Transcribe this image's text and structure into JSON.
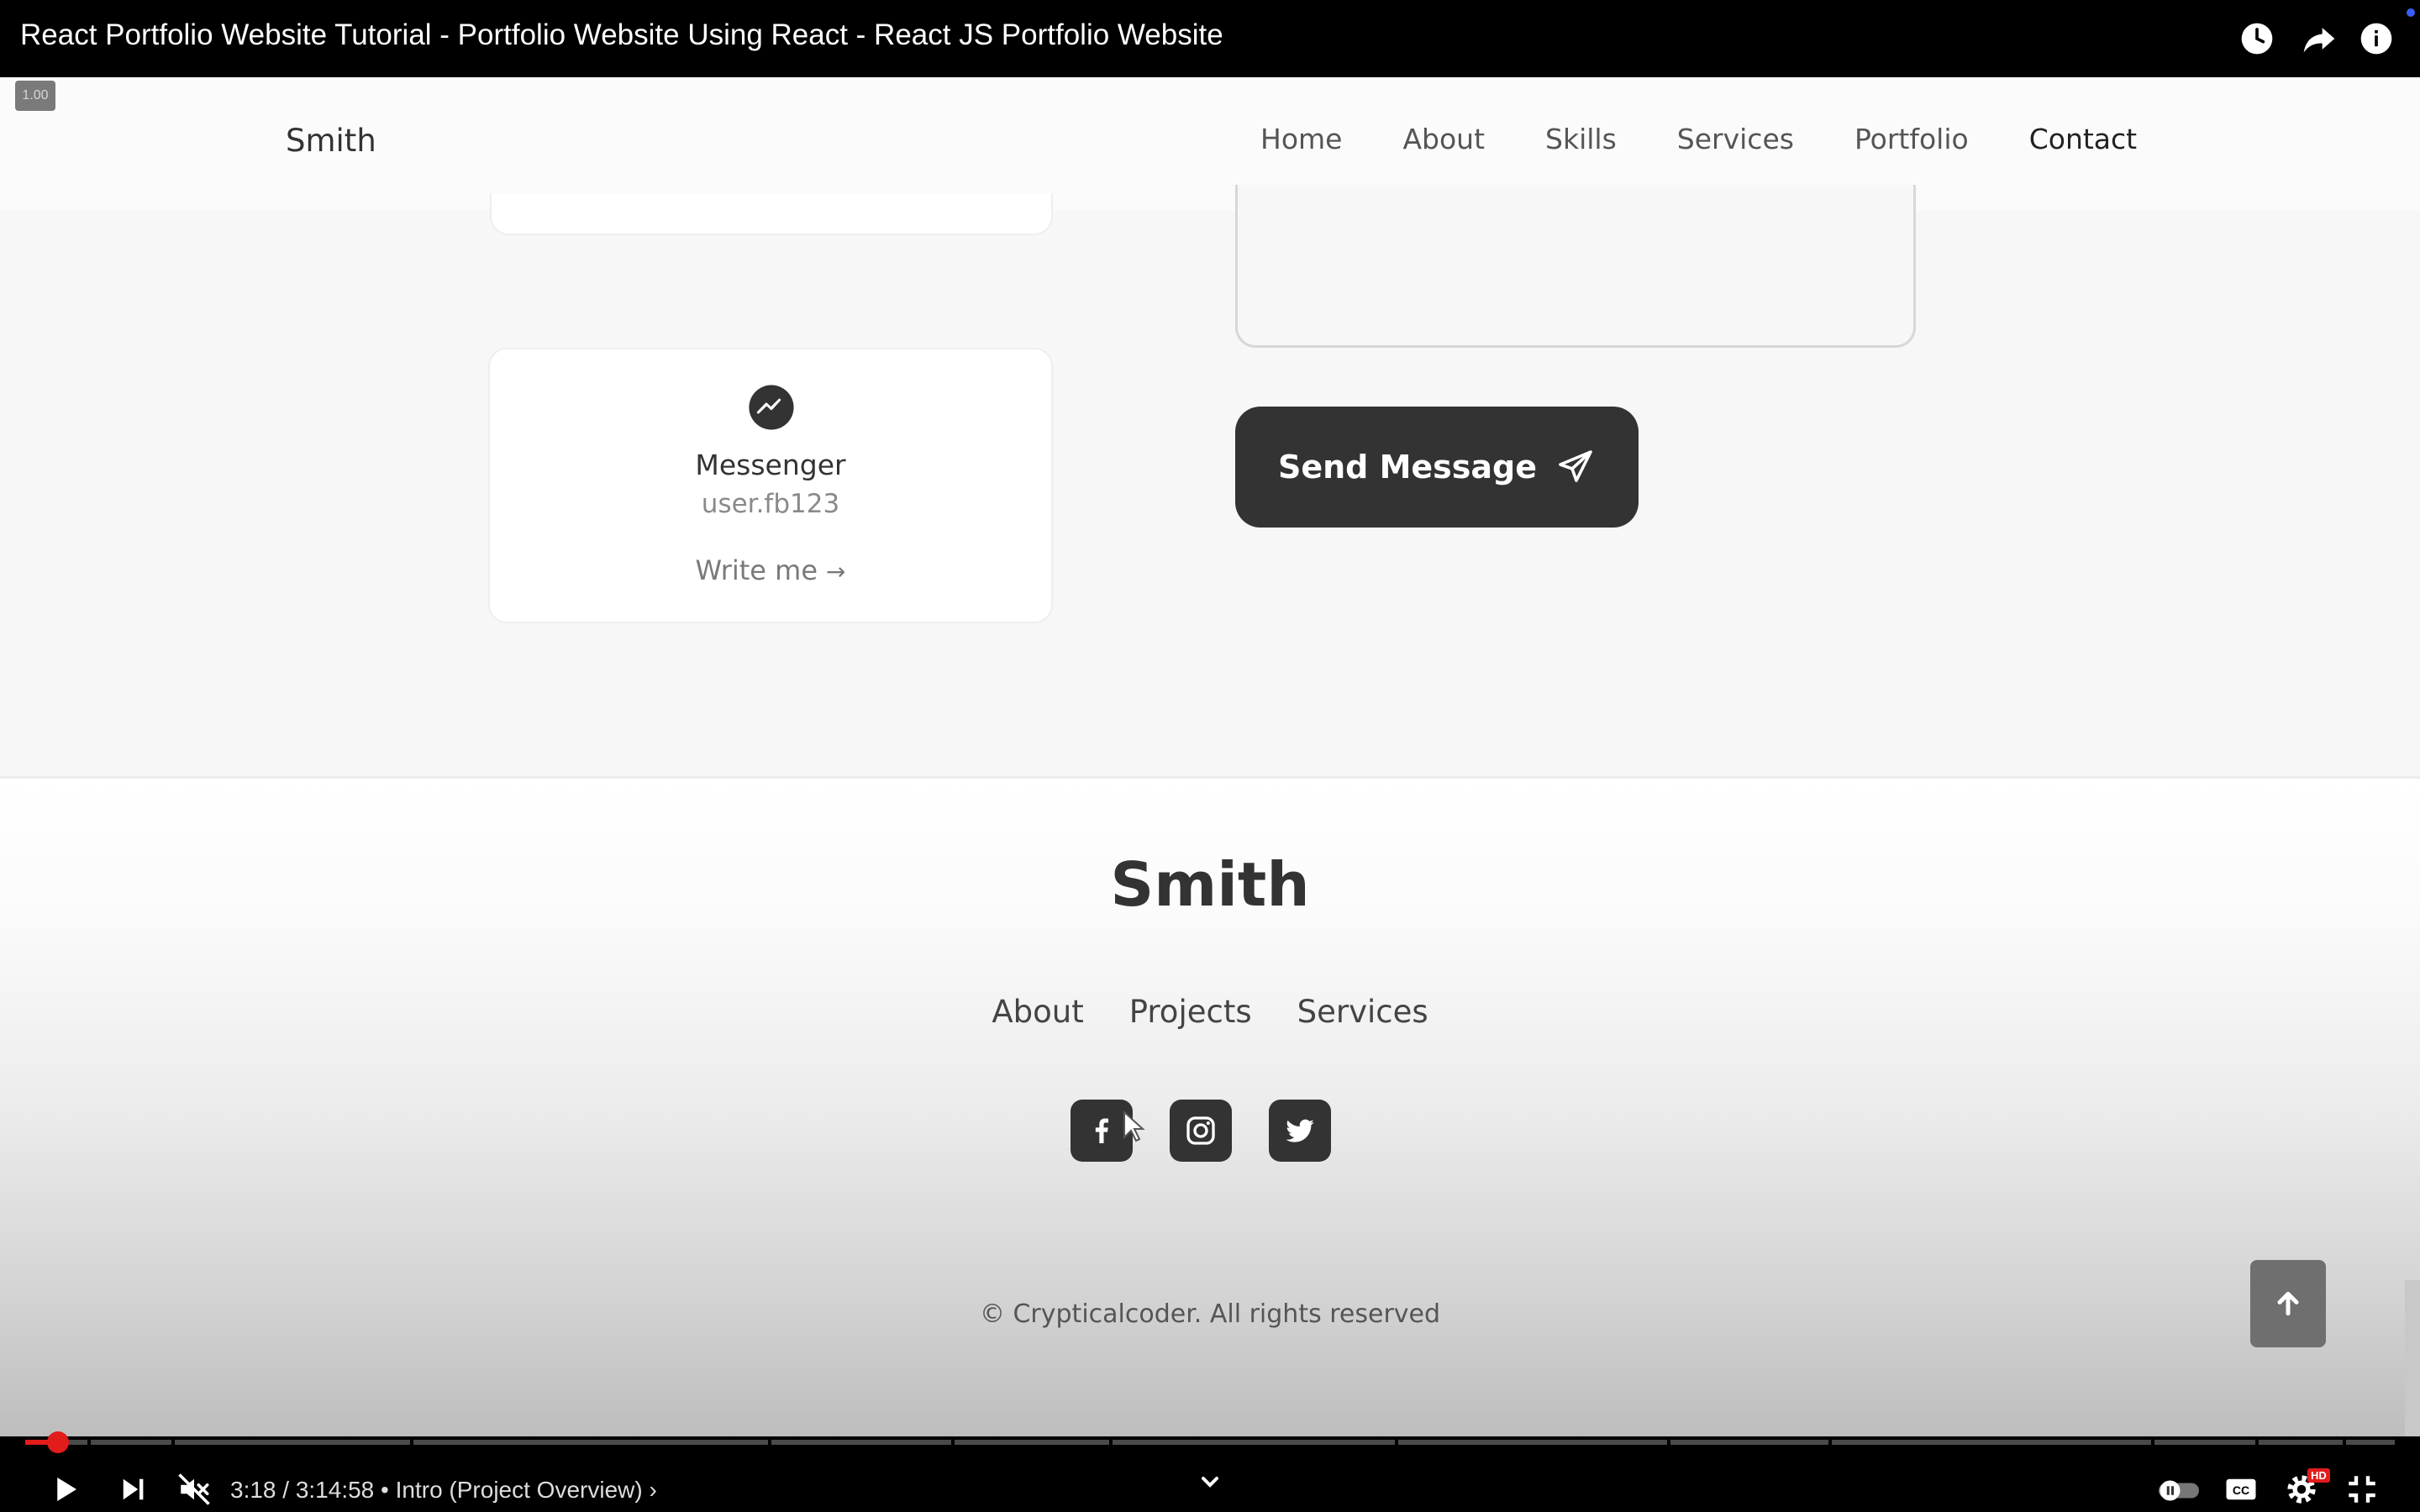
{
  "video": {
    "title": "React Portfolio Website Tutorial - Portfolio Website Using React - React JS Portfolio Website",
    "speed_badge": "1.00"
  },
  "site": {
    "logo": "Smith",
    "nav": [
      "Home",
      "About",
      "Skills",
      "Services",
      "Portfolio",
      "Contact"
    ],
    "active_nav": "Contact"
  },
  "contact": {
    "card": {
      "title": "Messenger",
      "data": "user.fb123",
      "link": "Write me",
      "link_arrow": "→"
    },
    "send_button": "Send Message"
  },
  "footer": {
    "logo": "Smith",
    "links": [
      "About",
      "Projects",
      "Services"
    ],
    "social": [
      "facebook-icon",
      "instagram-icon",
      "twitter-icon"
    ],
    "copyright": "© Crypticalcoder. All rights reserved"
  },
  "player": {
    "time": "3:18 / 3:14:58",
    "chapter": "• Intro (Project Overview) ›",
    "played_fraction": 0.014,
    "quality_badge": "HD"
  },
  "colors": {
    "accent_red": "#e21b1b",
    "button_dark": "#333333"
  }
}
